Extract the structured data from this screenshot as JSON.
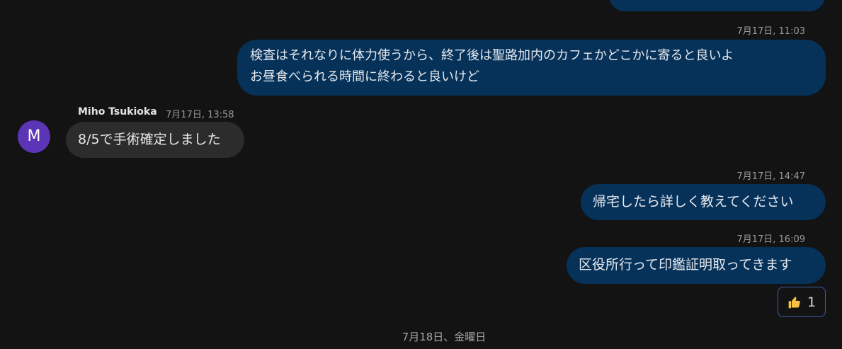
{
  "messages": {
    "top_partial": {},
    "m1": {
      "timestamp": "7月17日, 11:03",
      "line1": "検査はそれなりに体力使うから、終了後は聖路加内のカフェかどこかに寄ると良いよ",
      "line2": "お昼食べられる時間に終わると良いけど"
    },
    "m2": {
      "sender": "Miho Tsukioka",
      "avatar_letter": "M",
      "avatar_color": "#5b35b5",
      "timestamp": "7月17日, 13:58",
      "text": "8/5で手術確定しました"
    },
    "m3": {
      "timestamp": "7月17日, 14:47",
      "text": "帰宅したら詳しく教えてください"
    },
    "m4": {
      "timestamp": "7月17日, 16:09",
      "text": "区役所行って印鑑証明取ってきます",
      "reaction": {
        "icon": "thumbs-up-icon",
        "count": "1"
      }
    }
  },
  "date_divider": "7月18日、金曜日",
  "colors": {
    "background": "#131313",
    "outgoing_bubble": "#06325a",
    "incoming_bubble": "#2c2c2c",
    "reaction_border": "#3a5fa8"
  }
}
